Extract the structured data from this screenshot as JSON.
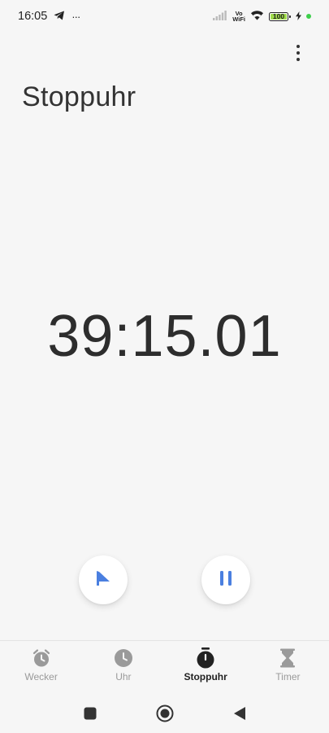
{
  "status_bar": {
    "time": "16:05",
    "overflow": "···",
    "vowifi_top": "Vo",
    "vowifi_bottom": "WiFi",
    "battery": "100",
    "battery_color": "#9fdc4a",
    "charge_dot_color": "#3ecf4b",
    "icons": [
      "telegram-icon",
      "signal-icon",
      "wifi-icon",
      "battery-icon",
      "charging-icon"
    ]
  },
  "header": {
    "title": "Stoppuhr",
    "menu_icon": "more-vert-icon"
  },
  "stopwatch": {
    "elapsed": "39:15.01",
    "accent_color": "#4a7fe0"
  },
  "controls": {
    "lap_icon": "flag-icon",
    "pause_icon": "pause-icon"
  },
  "bottom_nav": {
    "items": [
      {
        "label": "Wecker",
        "icon": "alarm-icon",
        "active": false
      },
      {
        "label": "Uhr",
        "icon": "clock-icon",
        "active": false
      },
      {
        "label": "Stoppuhr",
        "icon": "stopwatch-icon",
        "active": true
      },
      {
        "label": "Timer",
        "icon": "hourglass-icon",
        "active": false
      }
    ]
  },
  "system_nav": {
    "icons": [
      "recents-icon",
      "home-icon",
      "back-icon"
    ]
  }
}
